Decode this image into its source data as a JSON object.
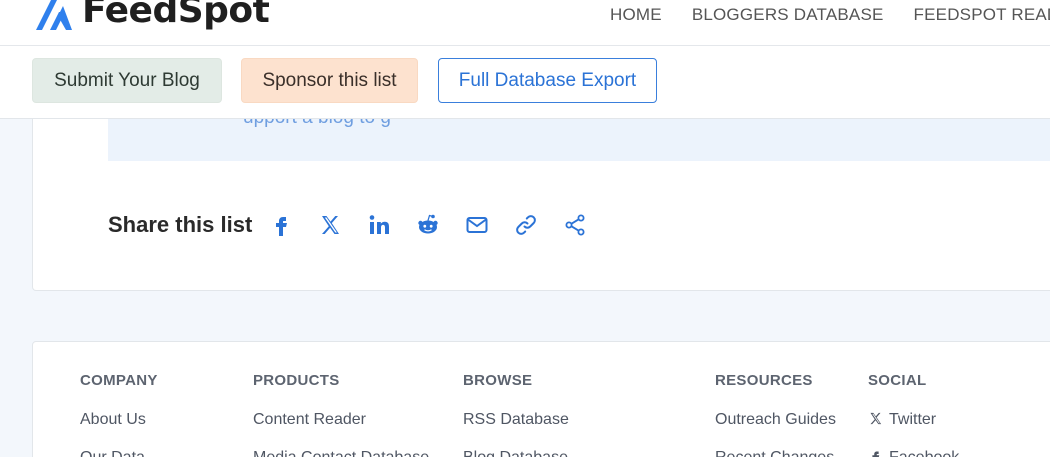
{
  "brand": {
    "name": "FeedSpot",
    "accent": "#2b73d6"
  },
  "nav": [
    "HOME",
    "BLOGGERS DATABASE",
    "FEEDSPOT READER"
  ],
  "actions": {
    "submit": "Submit Your Blog",
    "sponsor": "Sponsor this list",
    "export": "Full Database Export"
  },
  "content": {
    "partial_text": "upport a blog to g",
    "share_title": "Share this list",
    "share_icons": [
      "facebook-icon",
      "x-twitter-icon",
      "linkedin-icon",
      "reddit-icon",
      "email-icon",
      "link-icon",
      "share-icon"
    ]
  },
  "footer": {
    "company": {
      "heading": "COMPANY",
      "links": [
        "About Us",
        "Our Data"
      ]
    },
    "products": {
      "heading": "PRODUCTS",
      "links": [
        "Content Reader",
        "Media Contact Database"
      ]
    },
    "browse": {
      "heading": "BROWSE",
      "links": [
        "RSS Database",
        "Blog Database"
      ]
    },
    "resources": {
      "heading": "RESOURCES",
      "links": [
        "Outreach Guides",
        "Recent Changes"
      ]
    },
    "social": {
      "heading": "SOCIAL",
      "links": [
        "Twitter",
        "Facebook"
      ]
    }
  }
}
